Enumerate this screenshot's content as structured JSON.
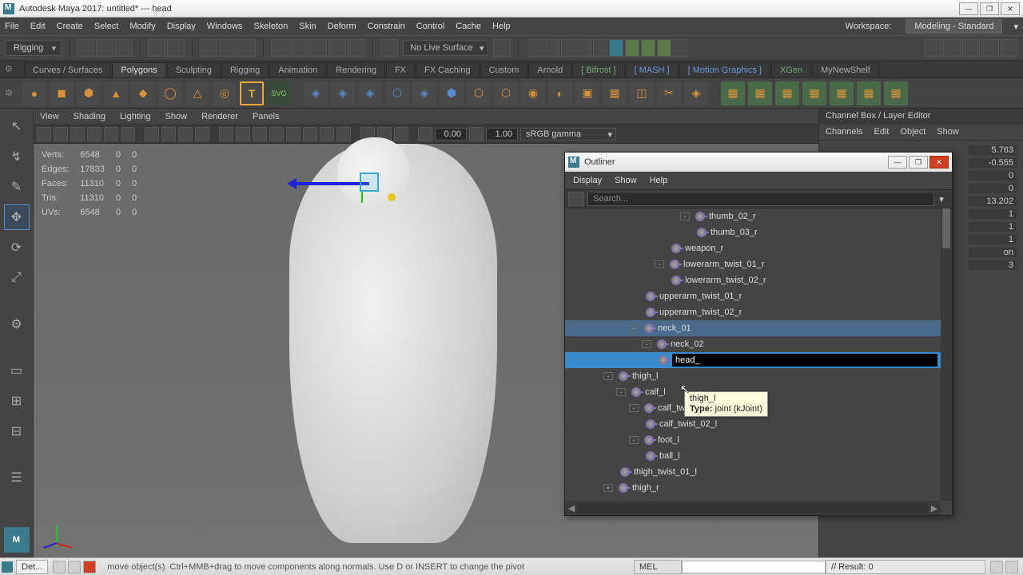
{
  "title": "Autodesk Maya 2017: untitled*  ---  head",
  "menu": [
    "File",
    "Edit",
    "Create",
    "Select",
    "Modify",
    "Display",
    "Windows",
    "Skeleton",
    "Skin",
    "Deform",
    "Constrain",
    "Control",
    "Cache",
    "Help"
  ],
  "workspace_label": "Workspace:",
  "workspace_value": "Modeling - Standard",
  "module_dropdown": "Rigging",
  "live_surface": "No Live Surface",
  "shelf_tabs": [
    "Curves / Surfaces",
    "Polygons",
    "Sculpting",
    "Rigging",
    "Animation",
    "Rendering",
    "FX",
    "FX Caching",
    "Custom",
    "Arnold",
    "Bifrost",
    "MASH",
    "Motion Graphics",
    "XGen",
    "MyNewShelf"
  ],
  "shelf_active_index": 1,
  "viewport_menu": [
    "View",
    "Shading",
    "Lighting",
    "Show",
    "Renderer",
    "Panels"
  ],
  "vt_num1": "0.00",
  "vt_num2": "1.00",
  "vt_dd": "sRGB gamma",
  "stats": [
    {
      "label": "Verts:",
      "a": "6548",
      "b": "0",
      "c": "0"
    },
    {
      "label": "Edges:",
      "a": "17833",
      "b": "0",
      "c": "0"
    },
    {
      "label": "Faces:",
      "a": "11310",
      "b": "0",
      "c": "0"
    },
    {
      "label": "Tris:",
      "a": "11310",
      "b": "0",
      "c": "0"
    },
    {
      "label": "UVs:",
      "a": "6548",
      "b": "0",
      "c": "0"
    }
  ],
  "channelbox": {
    "title": "Channel Box / Layer Editor",
    "menu": [
      "Channels",
      "Edit",
      "Object",
      "Show"
    ],
    "rows": [
      {
        "label": "",
        "value": "5.763"
      },
      {
        "label": "",
        "value": "-0.555"
      },
      {
        "label": "",
        "value": "0"
      },
      {
        "label": "",
        "value": "0"
      },
      {
        "label": "",
        "value": "13.202"
      },
      {
        "label": "",
        "value": "1"
      },
      {
        "label": "",
        "value": "1"
      },
      {
        "label": "",
        "value": "1"
      },
      {
        "label": "",
        "value": "on"
      },
      {
        "label": "",
        "value": "3"
      }
    ]
  },
  "outliner": {
    "title": "Outliner",
    "menu": [
      "Display",
      "Show",
      "Help"
    ],
    "search_placeholder": "Search...",
    "edit_value": "head_",
    "tree": [
      {
        "indent": 9,
        "expand": "-",
        "name": "thumb_02_r"
      },
      {
        "indent": 10,
        "name": "thumb_03_r"
      },
      {
        "indent": 8,
        "name": "weapon_r"
      },
      {
        "indent": 7,
        "expand": "-",
        "name": "lowerarm_twist_01_r"
      },
      {
        "indent": 8,
        "name": "lowerarm_twist_02_r"
      },
      {
        "indent": 6,
        "name": "upperarm_twist_01_r"
      },
      {
        "indent": 6,
        "name": "upperarm_twist_02_r"
      },
      {
        "indent": 5,
        "expand": "-",
        "name": "neck_01",
        "sel": true
      },
      {
        "indent": 6,
        "expand": "-",
        "name": "neck_02"
      },
      {
        "indent": 7,
        "edit": true
      },
      {
        "indent": 3,
        "expand": "-",
        "name": "thigh_l"
      },
      {
        "indent": 4,
        "expand": "-",
        "name": "calf_l"
      },
      {
        "indent": 5,
        "expand": "-",
        "name": "calf_twi..."
      },
      {
        "indent": 6,
        "name": "calf_twist_02_l"
      },
      {
        "indent": 5,
        "expand": "-",
        "name": "foot_l"
      },
      {
        "indent": 6,
        "name": "ball_l"
      },
      {
        "indent": 4,
        "name": "thigh_twist_01_l"
      },
      {
        "indent": 3,
        "expand": "+",
        "name": "thigh_r"
      }
    ]
  },
  "tooltip_name": "thigh_l",
  "tooltip_type_label": "Type:",
  "tooltip_type": "joint (kJoint)",
  "status_tab": "Det...",
  "status_help": "move object(s). Ctrl+MMB+drag to move components along normals. Use D or INSERT to change the pivot",
  "status_mel": "MEL",
  "status_result": "// Result: 0"
}
